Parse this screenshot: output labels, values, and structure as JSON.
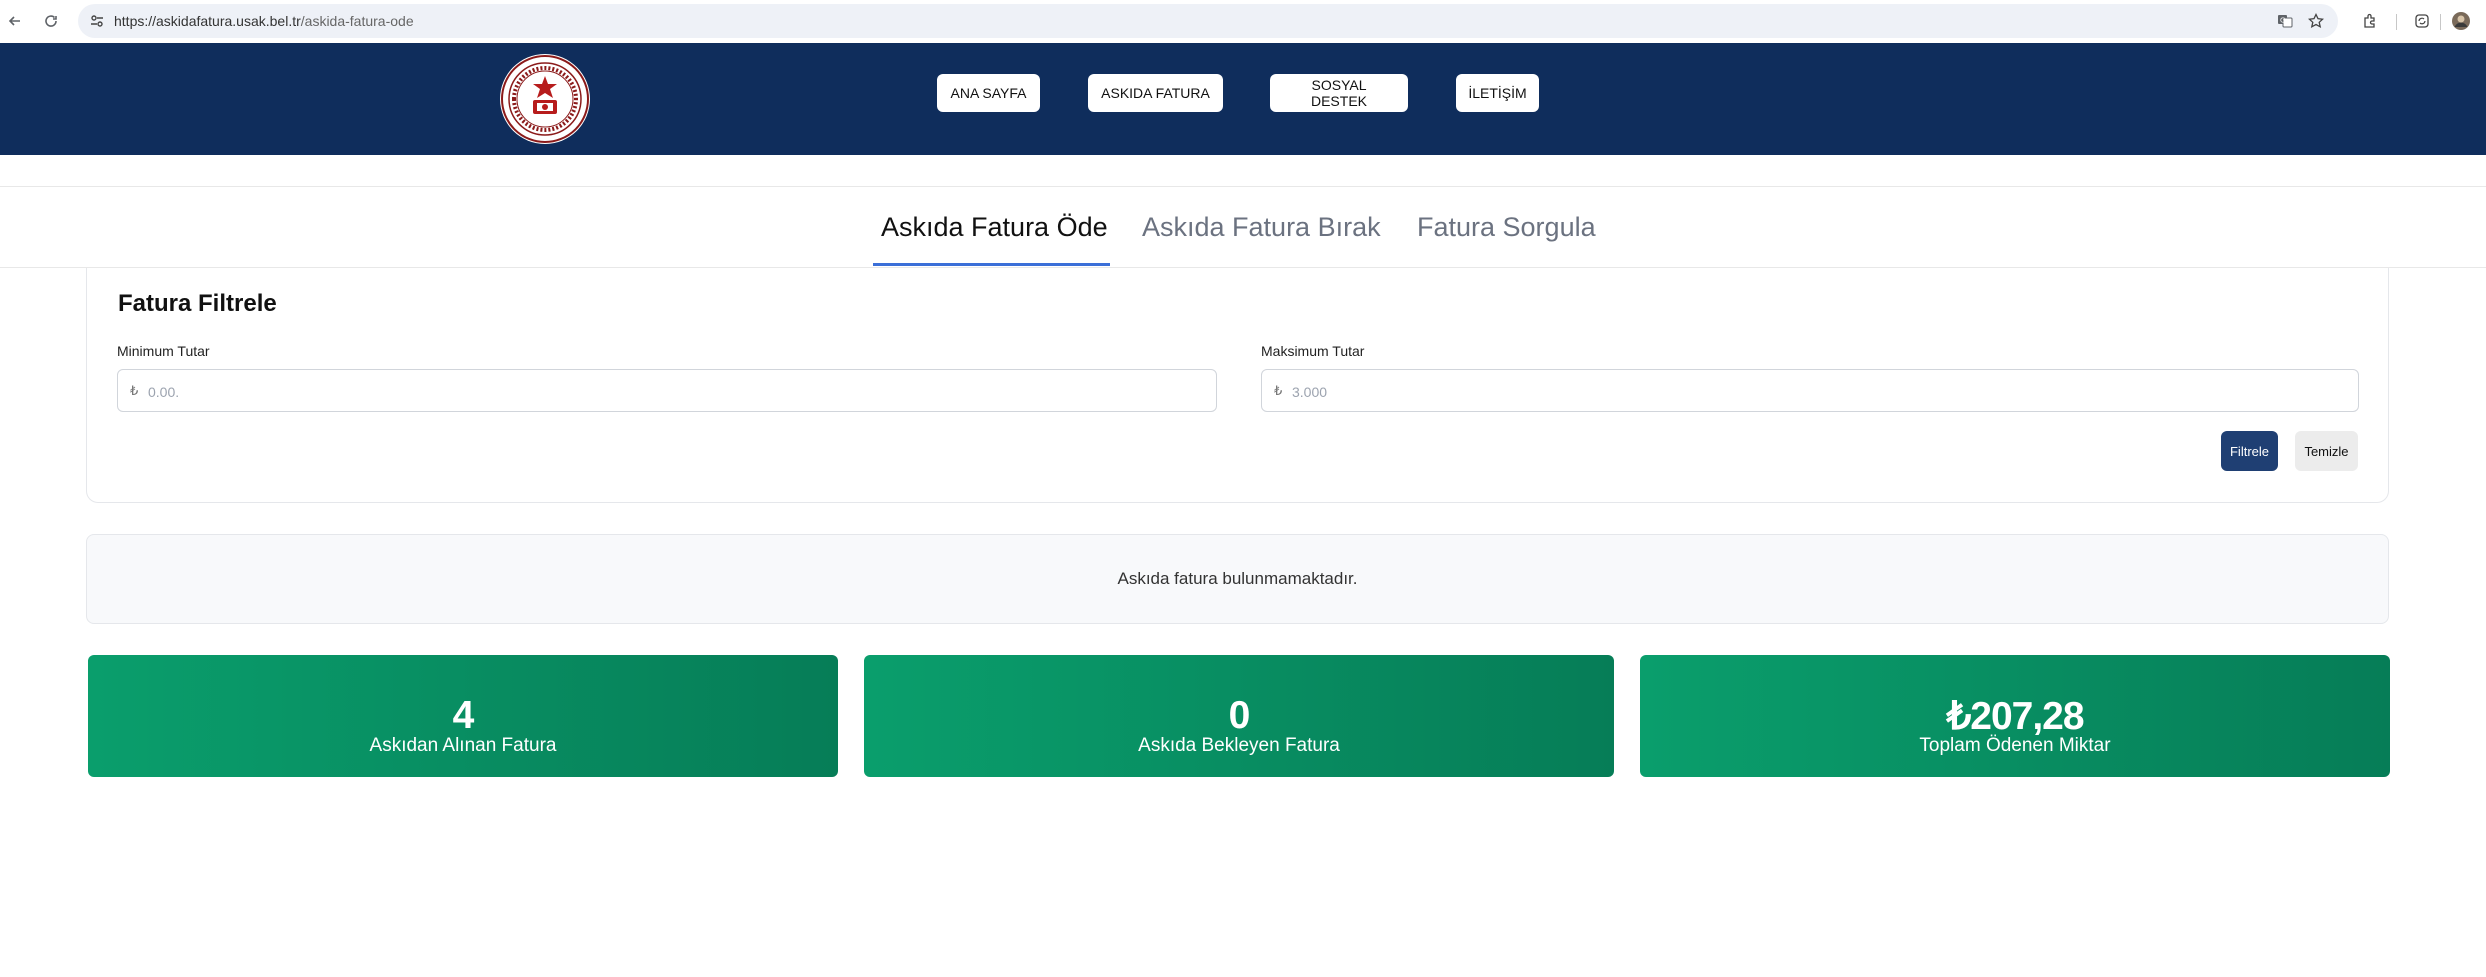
{
  "browser": {
    "url_host": "https://askidafatura.usak.bel.tr",
    "url_path": "/askida-fatura-ode",
    "icons": [
      "back-icon",
      "reload-icon",
      "site-info-icon",
      "translate-icon",
      "bookmark-star-icon",
      "extensions-icon",
      "sync-icon",
      "profile-avatar"
    ]
  },
  "header": {
    "logo_icon": "municipality-logo",
    "nav": [
      "ANA SAYFA",
      "ASKIDA FATURA",
      "SOSYAL DESTEK",
      "İLETİŞİM"
    ],
    "background_color": "#0f2d5c"
  },
  "tabs": [
    {
      "label": "Askıda Fatura Öde",
      "active": true
    },
    {
      "label": "Askıda Fatura Bırak",
      "active": false
    },
    {
      "label": "Fatura Sorgula",
      "active": false
    }
  ],
  "filter": {
    "title": "Fatura Filtrele",
    "min_label": "Minimum Tutar",
    "min_placeholder": "0.00.",
    "max_label": "Maksimum Tutar",
    "max_placeholder": "3.000",
    "currency_symbol": "₺",
    "filter_button": "Filtrele",
    "clear_button": "Temizle",
    "filter_button_color": "#1f3f73"
  },
  "empty_message": "Askıda fatura bulunmamaktadır.",
  "stats": [
    {
      "value": "4",
      "label": "Askıdan Alınan Fatura"
    },
    {
      "value": "0",
      "label": "Askıda Bekleyen Fatura"
    },
    {
      "value": "₺207,28",
      "label": "Toplam Ödenen Miktar"
    }
  ],
  "stat_card_color": "#0a9e6c"
}
